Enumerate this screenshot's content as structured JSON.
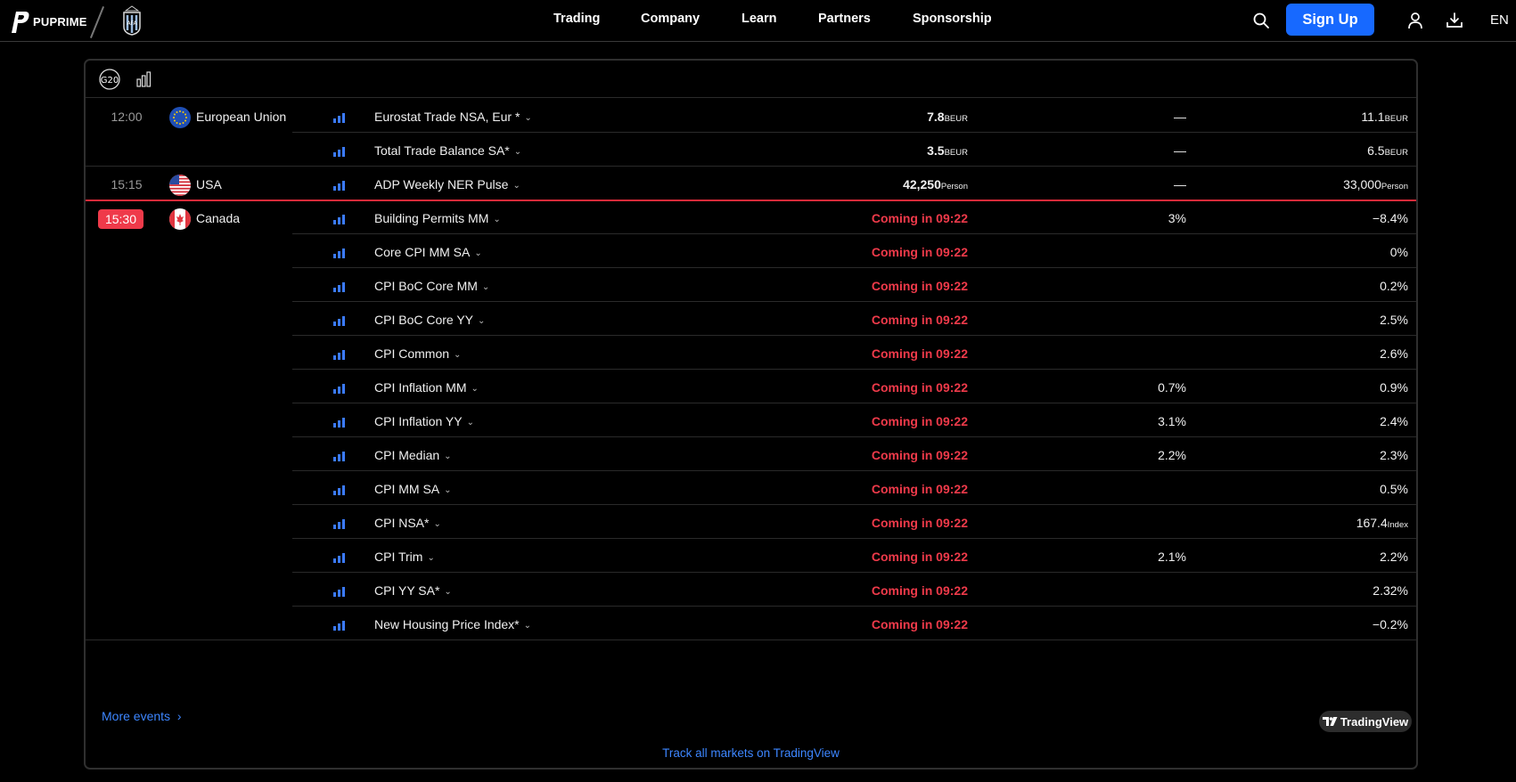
{
  "nav": {
    "brand": "PUPRIME",
    "links": [
      "Trading",
      "Company",
      "Learn",
      "Partners",
      "Sponsorship"
    ],
    "signup": "Sign Up",
    "lang": "EN",
    "icons": [
      "search-icon",
      "user-icon",
      "download-icon"
    ]
  },
  "toolbar": {
    "g20_label": "G20"
  },
  "colors": {
    "accent": "#1769ff",
    "alert": "#ef3a4a",
    "link": "#3d86ff"
  },
  "events": [
    {
      "time": "12:00",
      "country": "European Union",
      "flag": "eu",
      "event": "Eurostat Trade NSA, Eur *",
      "actual": "7.8",
      "actual_unit": "BEUR",
      "forecast": "—",
      "prior": "11.1",
      "prior_unit": "BEUR"
    },
    {
      "time": "",
      "country": "",
      "flag": "",
      "event": "Total Trade Balance SA*",
      "actual": "3.5",
      "actual_unit": "BEUR",
      "forecast": "—",
      "prior": "6.5",
      "prior_unit": "BEUR"
    },
    {
      "time": "15:15",
      "country": "USA",
      "flag": "us",
      "event": "ADP Weekly NER Pulse",
      "actual": "42,250",
      "actual_unit": "Person",
      "forecast": "—",
      "prior": "33,000",
      "prior_unit": "Person"
    },
    {
      "time": "15:30",
      "current": true,
      "country": "Canada",
      "flag": "ca",
      "event": "Building Permits MM",
      "actual": "Coming in 09:22",
      "forecast": "3%",
      "prior": "−8.4%"
    },
    {
      "time": "",
      "country": "",
      "flag": "",
      "event": "Core CPI MM SA",
      "actual": "Coming in 09:22",
      "forecast": "",
      "prior": "0%"
    },
    {
      "time": "",
      "country": "",
      "flag": "",
      "event": "CPI BoC Core MM",
      "actual": "Coming in 09:22",
      "forecast": "",
      "prior": "0.2%"
    },
    {
      "time": "",
      "country": "",
      "flag": "",
      "event": "CPI BoC Core YY",
      "actual": "Coming in 09:22",
      "forecast": "",
      "prior": "2.5%"
    },
    {
      "time": "",
      "country": "",
      "flag": "",
      "event": "CPI Common",
      "actual": "Coming in 09:22",
      "forecast": "",
      "prior": "2.6%"
    },
    {
      "time": "",
      "country": "",
      "flag": "",
      "event": "CPI Inflation MM",
      "actual": "Coming in 09:22",
      "forecast": "0.7%",
      "prior": "0.9%"
    },
    {
      "time": "",
      "country": "",
      "flag": "",
      "event": "CPI Inflation YY",
      "actual": "Coming in 09:22",
      "forecast": "3.1%",
      "prior": "2.4%"
    },
    {
      "time": "",
      "country": "",
      "flag": "",
      "event": "CPI Median",
      "actual": "Coming in 09:22",
      "forecast": "2.2%",
      "prior": "2.3%"
    },
    {
      "time": "",
      "country": "",
      "flag": "",
      "event": "CPI MM SA",
      "actual": "Coming in 09:22",
      "forecast": "",
      "prior": "0.5%"
    },
    {
      "time": "",
      "country": "",
      "flag": "",
      "event": "CPI NSA*",
      "actual": "Coming in 09:22",
      "forecast": "",
      "prior": "167.4",
      "prior_unit": "Index"
    },
    {
      "time": "",
      "country": "",
      "flag": "",
      "event": "CPI Trim",
      "actual": "Coming in 09:22",
      "forecast": "2.1%",
      "prior": "2.2%"
    },
    {
      "time": "",
      "country": "",
      "flag": "",
      "event": "CPI YY SA*",
      "actual": "Coming in 09:22",
      "forecast": "",
      "prior": "2.32%"
    },
    {
      "time": "",
      "country": "",
      "flag": "",
      "event": "New Housing Price Index*",
      "actual": "Coming in 09:22",
      "forecast": "",
      "prior": "−0.2%"
    }
  ],
  "footer": {
    "more_events": "More events",
    "tv_badge": "TradingView",
    "track": "Track all markets on TradingView"
  }
}
